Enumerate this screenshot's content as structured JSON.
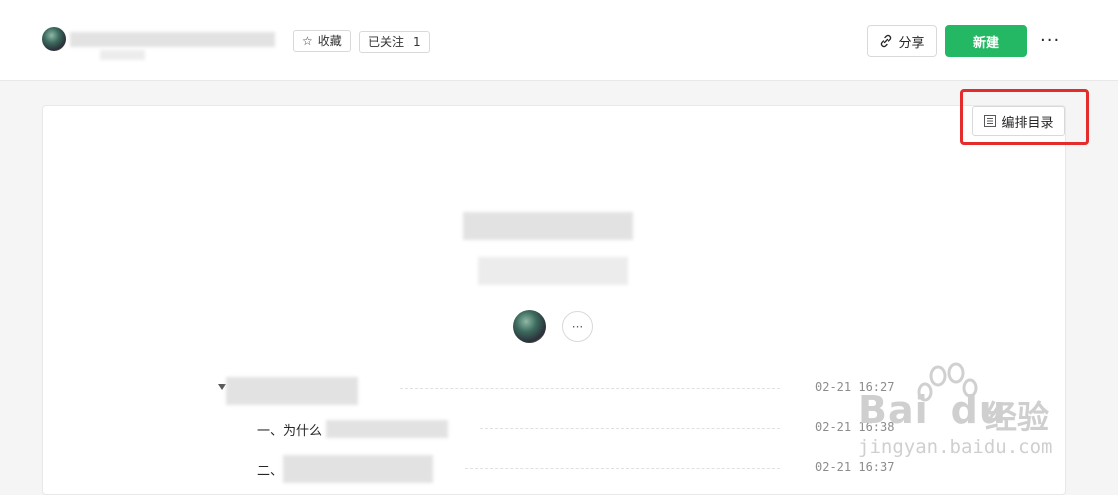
{
  "header": {
    "follow_icon": "star-icon",
    "favorite_label": "收藏",
    "followed_label": "已关注",
    "followed_count": "1",
    "share_icon": "link-icon",
    "share_label": "分享",
    "new_label": "新建",
    "more_label": "···"
  },
  "toolbar": {
    "toc_icon": "list-icon",
    "toc_label": "编排目录"
  },
  "doc": {
    "more_label": "···"
  },
  "toc": {
    "items": [
      {
        "label": "",
        "time": "02-21 16:27"
      },
      {
        "label": "一、为什么",
        "time": "02-21 16:38"
      },
      {
        "label": "二、",
        "time": "02-21 16:37"
      }
    ]
  },
  "watermark": {
    "brand": "Bai",
    "brand2": "du",
    "cn": "经验",
    "url": "jingyan.baidu.com"
  },
  "colors": {
    "accent": "#25b864",
    "highlight": "#e52c2c"
  }
}
